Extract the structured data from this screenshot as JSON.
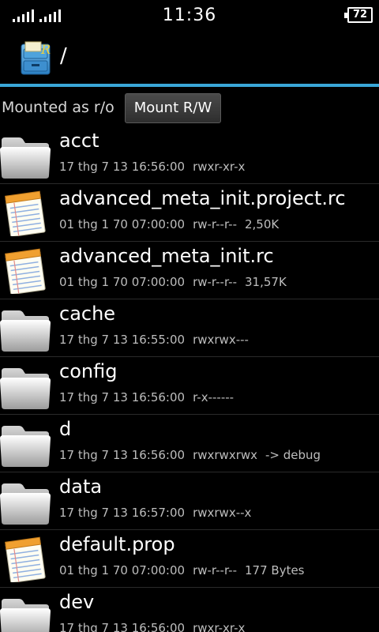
{
  "status_bar": {
    "time": "11:36",
    "battery": "72"
  },
  "title_bar": {
    "path": "/"
  },
  "mount_bar": {
    "status": "Mounted as r/o",
    "button": "Mount R/W"
  },
  "files": [
    {
      "name": "acct",
      "type": "folder",
      "date": "17 thg 7 13 16:56:00",
      "perms": "rwxr-xr-x",
      "extra": ""
    },
    {
      "name": "advanced_meta_init.project.rc",
      "type": "file",
      "date": "01 thg 1 70 07:00:00",
      "perms": "rw-r--r--",
      "extra": "2,50K"
    },
    {
      "name": "advanced_meta_init.rc",
      "type": "file",
      "date": "01 thg 1 70 07:00:00",
      "perms": "rw-r--r--",
      "extra": "31,57K"
    },
    {
      "name": "cache",
      "type": "folder",
      "date": "17 thg 7 13 16:55:00",
      "perms": "rwxrwx---",
      "extra": ""
    },
    {
      "name": "config",
      "type": "folder",
      "date": "17 thg 7 13 16:56:00",
      "perms": "r-x------",
      "extra": ""
    },
    {
      "name": "d",
      "type": "folder",
      "date": "17 thg 7 13 16:56:00",
      "perms": "rwxrwxrwx",
      "extra": "-> debug"
    },
    {
      "name": "data",
      "type": "folder",
      "date": "17 thg 7 13 16:57:00",
      "perms": "rwxrwx--x",
      "extra": ""
    },
    {
      "name": "default.prop",
      "type": "file",
      "date": "01 thg 1 70 07:00:00",
      "perms": "rw-r--r--",
      "extra": "177 Bytes"
    },
    {
      "name": "dev",
      "type": "folder",
      "date": "17 thg 7 13 16:56:00",
      "perms": "rwxr-xr-x",
      "extra": ""
    }
  ]
}
